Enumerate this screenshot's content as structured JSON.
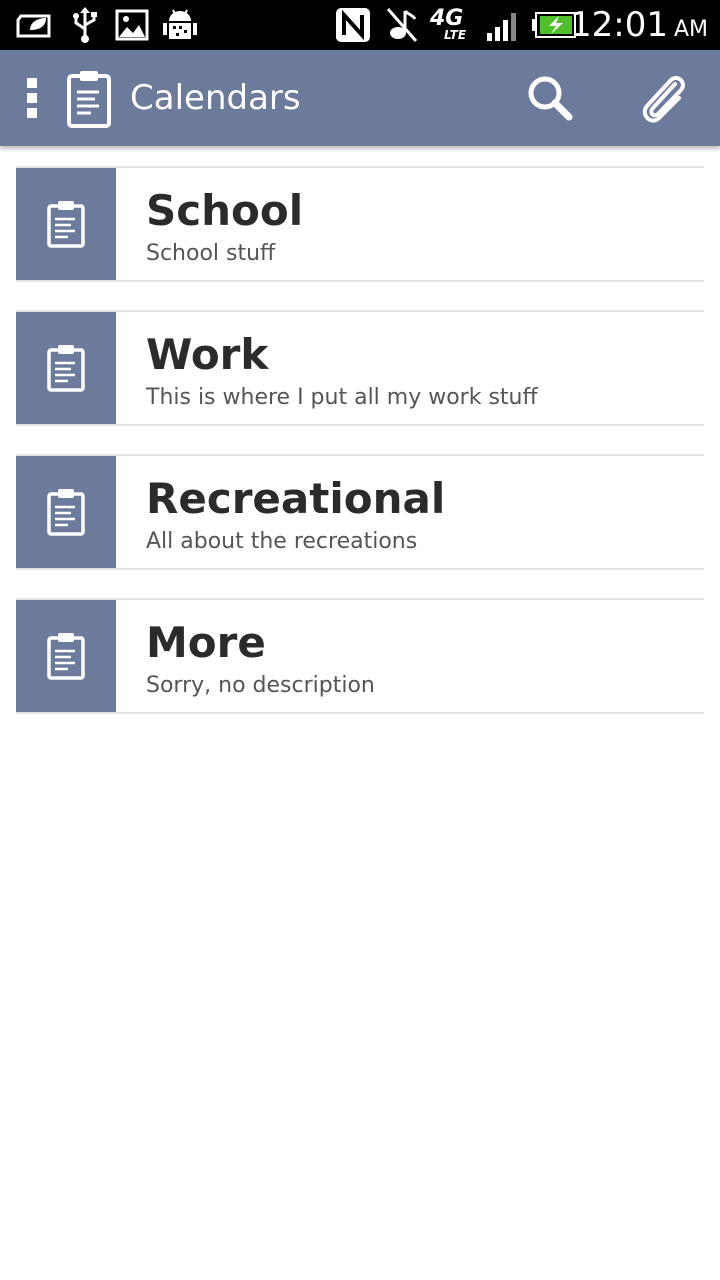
{
  "status_bar": {
    "time": "12:01",
    "ampm": "AM",
    "network_label": "4G",
    "network_sub": "LTE",
    "left_icons": [
      "leaf-card-icon",
      "usb-icon",
      "image-icon",
      "android-debug-icon"
    ],
    "right_icons": [
      "nfc-icon",
      "silent-icon",
      "4g-lte-icon",
      "signal-icon",
      "battery-charging-icon"
    ]
  },
  "action_bar": {
    "title": "Calendars",
    "background": "#6c7a9c",
    "actions": [
      "search-icon",
      "attach-icon"
    ]
  },
  "calendars": [
    {
      "title": "School",
      "description": "School stuff"
    },
    {
      "title": "Work",
      "description": "This is where I put all my work stuff"
    },
    {
      "title": "Recreational",
      "description": "All about the recreations"
    },
    {
      "title": "More",
      "description": "Sorry, no description"
    }
  ]
}
